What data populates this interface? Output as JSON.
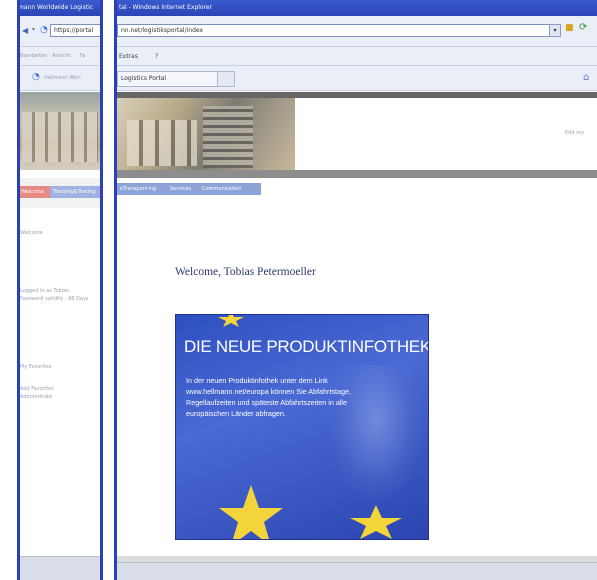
{
  "left_window": {
    "title": "mann Worldwide Logistic",
    "address": "https://portal",
    "menu": [
      "Bearbeiten",
      "Ansicht",
      "Fa"
    ],
    "tab_label": "Hellmann Worl",
    "nav_buttons": [
      "Welcome",
      "Tracking&Tracing"
    ],
    "side_texts": [
      "Welcome",
      "Logged in as Tobias",
      "Password validity : 98 Days",
      "My Favorites",
      "Add Favorites",
      "Administrate"
    ]
  },
  "right_window": {
    "title": "tal - Windows Internet Explorer",
    "address": "nn.net/logistiksportal/index",
    "menu": [
      "Extras",
      "?"
    ],
    "tab_label": "Logistics Portal",
    "nav_buttons": [
      "eTransport-ing",
      "Services",
      "Communication"
    ],
    "header_right": "Edit my"
  },
  "main": {
    "welcome": "Welcome, Tobias Petermoeller",
    "banner": {
      "title": "DIE NEUE PRODUKTINFOTHEK",
      "text": "In der neuen Produktinfothek unter dem Link www.hellmann.net/europa können Sie Abfahrtstage, Regellaufzeiten und späteste Abfahrtszeiten in alle europäischen Länder abfragen."
    }
  },
  "colors": {
    "frame_blue": "#2a3fb8",
    "nav_active": "#e58a85",
    "nav_inactive": "#8ea3d8",
    "banner_blue": "#3451c2",
    "welcome_text": "#2b3a6b"
  }
}
